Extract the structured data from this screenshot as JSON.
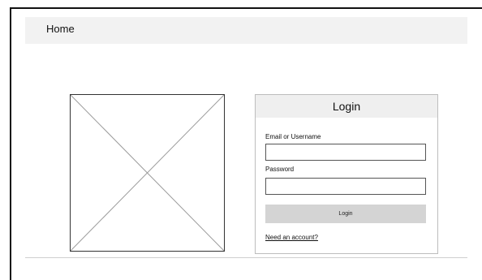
{
  "header": {
    "title": "Home"
  },
  "image_placeholder": {
    "icon": "image-placeholder-icon"
  },
  "login": {
    "title": "Login",
    "email_label": "Email or Username",
    "email_value": "",
    "password_label": "Password",
    "password_value": "",
    "submit_label": "Login",
    "signup_link": "Need an account?"
  },
  "colors": {
    "header_bg": "#f2f2f2",
    "panel_head_bg": "#efefef",
    "button_bg": "#d4d4d4",
    "frame": "#111111"
  }
}
